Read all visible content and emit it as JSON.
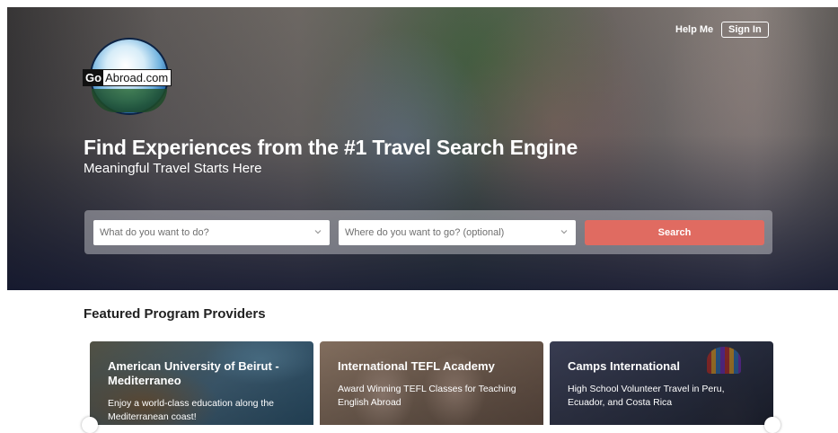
{
  "brand": {
    "logo_go": "Go",
    "logo_rest": "Abroad.com"
  },
  "header": {
    "help_label": "Help Me",
    "signin_label": "Sign In"
  },
  "hero": {
    "headline": "Find Experiences from the #1 Travel Search Engine",
    "subhead": "Meaningful Travel Starts Here"
  },
  "search": {
    "what_placeholder": "What do you want to do?",
    "where_placeholder": "Where do you want to go? (optional)",
    "button_label": "Search"
  },
  "featured": {
    "title": "Featured Program Providers",
    "cards": [
      {
        "title": "American University of Beirut - Mediterraneo",
        "desc": "Enjoy a world-class education along the Mediterranean coast!"
      },
      {
        "title": "International TEFL Academy",
        "desc": "Award Winning TEFL Classes for Teaching English Abroad"
      },
      {
        "title": "Camps International",
        "desc": "High School Volunteer Travel in Peru, Ecuador, and Costa Rica"
      }
    ]
  },
  "icons": {
    "select_chevron": "chevron-down-icon",
    "prev": "chevron-left-icon",
    "next": "chevron-right-icon"
  },
  "colors": {
    "search_button": "#e06b61",
    "heading_text": "#222222"
  }
}
